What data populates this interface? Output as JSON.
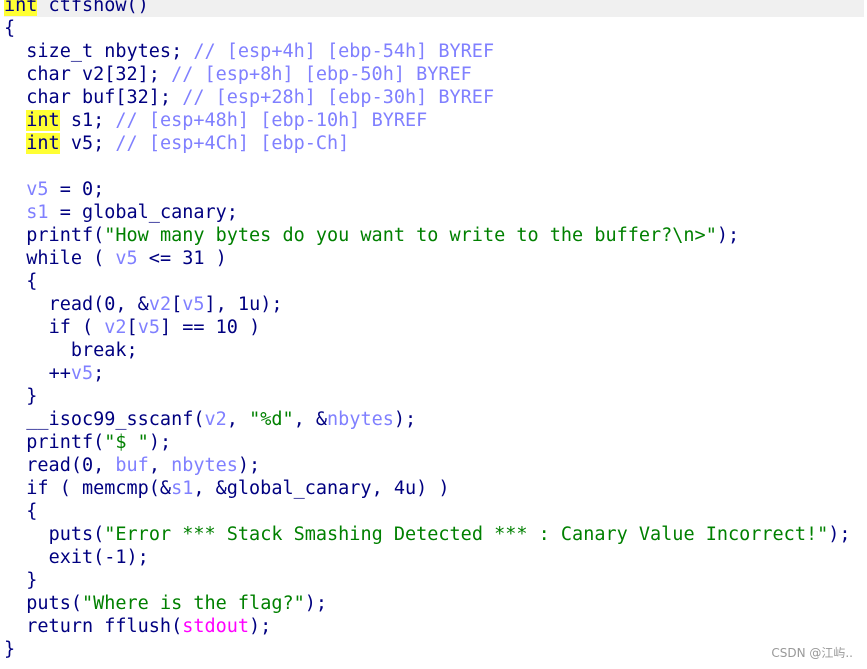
{
  "editor": {
    "header": {
      "ret_type": "int",
      "func": " ctfshow()"
    },
    "open_brace": "{",
    "decls": [
      {
        "code": "  size_t nbytes; ",
        "comment": "// [esp+4h] [ebp-54h] BYREF"
      },
      {
        "code": "  char v2[32]; ",
        "comment": "// [esp+8h] [ebp-50h] BYREF"
      },
      {
        "code": "  char buf[32]; ",
        "comment": "// [esp+28h] [ebp-30h] BYREF"
      }
    ],
    "int_decls": [
      {
        "type": "int",
        "code": " s1; ",
        "comment": "// [esp+48h] [ebp-10h] BYREF"
      },
      {
        "type": "int",
        "code": " v5; ",
        "comment": "// [esp+4Ch] [ebp-Ch]"
      }
    ],
    "l_v5_init": {
      "var": "v5",
      "rest": " = 0;"
    },
    "l_s1_assign": {
      "var": "s1",
      "rest": " = global_canary;"
    },
    "l_printf1": {
      "pre": "printf(",
      "str": "\"How many bytes do you want to write to the buffer?\\n>\"",
      "post": ");"
    },
    "l_while": {
      "pre": "while ( ",
      "var": "v5",
      "post": " <= 31 )"
    },
    "l_brace_open_1": "{",
    "l_read1": {
      "pre": "read(0, &",
      "v2": "v2",
      "mid": "[",
      "v5": "v5",
      "post": "], 1u);"
    },
    "l_if1": {
      "pre": "if ( ",
      "v2": "v2",
      "mid": "[",
      "v5": "v5",
      "post": "] == 10 )"
    },
    "l_break": "break;",
    "l_inc": {
      "pre": "++",
      "var": "v5",
      "post": ";"
    },
    "l_brace_close_1": "}",
    "l_sscanf": {
      "pre": "__isoc99_sscanf(",
      "v2": "v2",
      "mid": ", ",
      "str": "\"%d\"",
      "mid2": ", &",
      "nb": "nbytes",
      "post": ");"
    },
    "l_printf2": {
      "pre": "printf(",
      "str": "\"$ \"",
      "post": ");"
    },
    "l_read2": {
      "pre": "read(0, ",
      "buf": "buf",
      "mid": ", ",
      "nb": "nbytes",
      "post": ");"
    },
    "l_if2": {
      "pre": "if ( memcmp(&",
      "s1": "s1",
      "post": ", &global_canary, 4u) )"
    },
    "l_brace_open_2": "{",
    "l_puts1": {
      "pre": "puts(",
      "str": "\"Error *** Stack Smashing Detected *** : Canary Value Incorrect!\"",
      "post": ");"
    },
    "l_exit": "exit(-1);",
    "l_brace_close_2": "}",
    "l_puts2": {
      "pre": "puts(",
      "str": "\"Where is the flag?\"",
      "post": ");"
    },
    "l_return": {
      "pre": "return fflush(",
      "glb": "stdout",
      "post": ");"
    },
    "close_brace": "}"
  },
  "watermark": "CSDN @江屿.."
}
